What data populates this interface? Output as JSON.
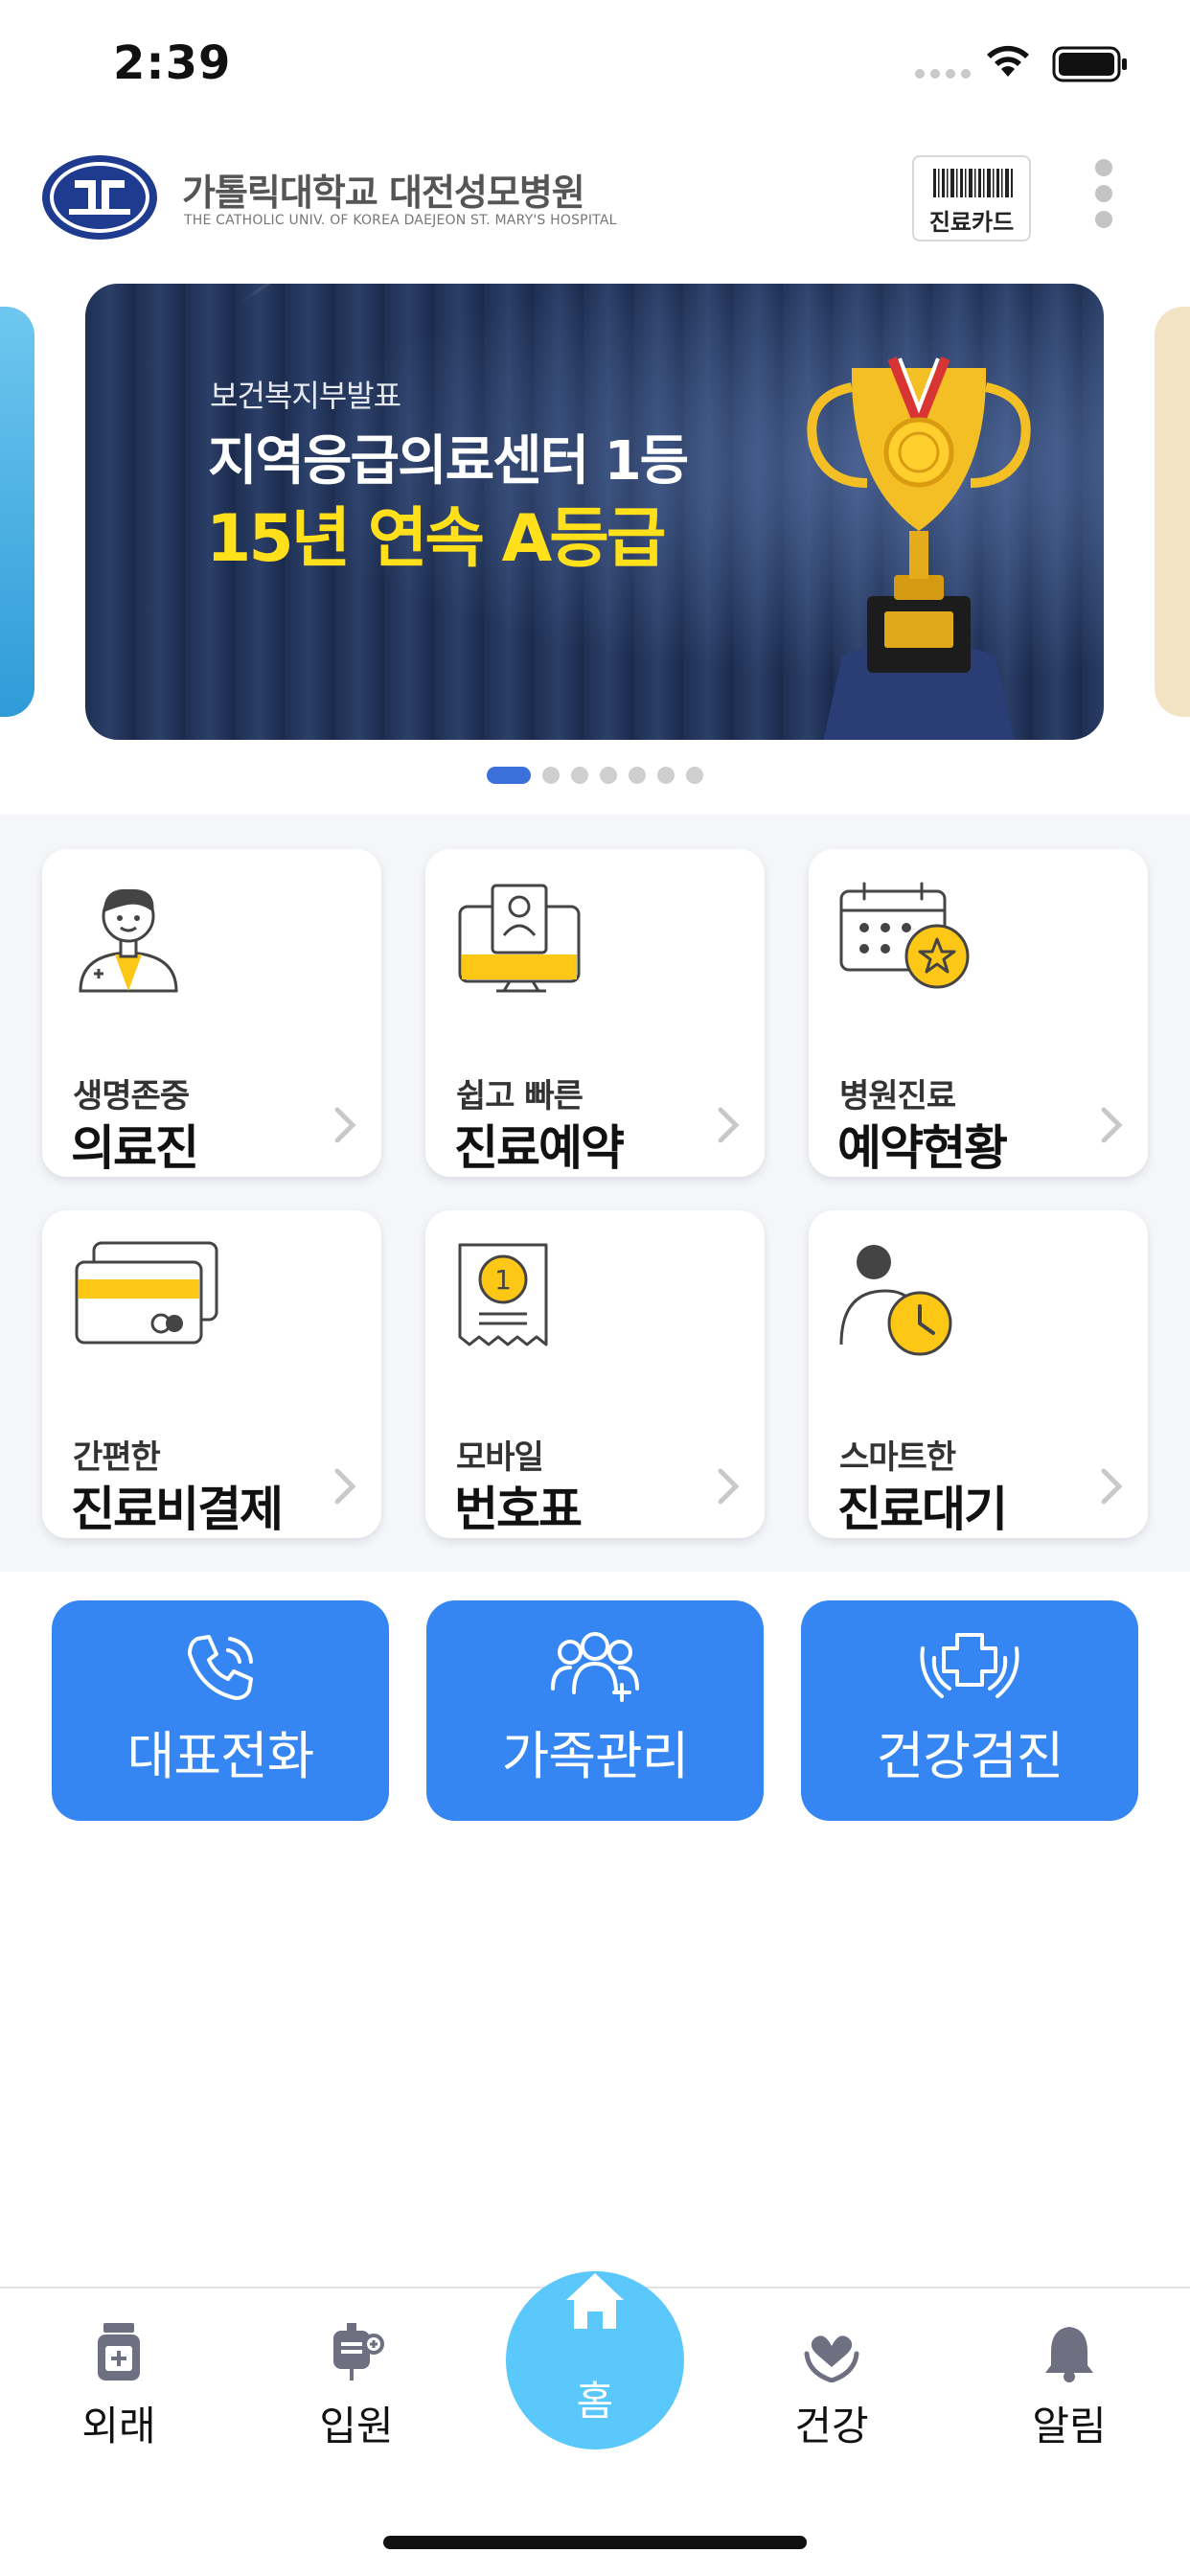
{
  "status_bar": {
    "time": "2:39"
  },
  "header": {
    "hospital_name": "가톨릭대학교 대전성모병원",
    "hospital_name_en": "THE CATHOLIC UNIV. OF KOREA DAEJEON ST. MARY'S HOSPITAL",
    "card_button_label": "진료카드"
  },
  "banner": {
    "kicker": "보건복지부발표",
    "line1": "지역응급의료센터 1등",
    "line2": "15년 연속 A등급",
    "slide_count": 7,
    "active_index": 0,
    "colors": {
      "highlight": "#ffe01a",
      "background": "#1e2f52"
    }
  },
  "menu": {
    "tiles": [
      {
        "sub": "생명존중",
        "main": "의료진",
        "icon": "doctor-icon"
      },
      {
        "sub": "쉽고 빠른",
        "main": "진료예약",
        "icon": "monitor-profile-icon"
      },
      {
        "sub": "병원진료",
        "main": "예약현황",
        "icon": "calendar-star-icon"
      },
      {
        "sub": "간편한",
        "main": "진료비결제",
        "icon": "credit-card-icon"
      },
      {
        "sub": "모바일",
        "main": "번호표",
        "icon": "ticket-number-icon"
      },
      {
        "sub": "스마트한",
        "main": "진료대기",
        "icon": "person-clock-icon"
      }
    ]
  },
  "quick_actions": [
    {
      "label": "대표전화",
      "icon": "phone-icon"
    },
    {
      "label": "가족관리",
      "icon": "family-icon"
    },
    {
      "label": "건강검진",
      "icon": "care-hands-icon"
    }
  ],
  "tabbar": {
    "tabs": [
      {
        "label": "외래",
        "icon": "medicine-bottle-icon"
      },
      {
        "label": "입원",
        "icon": "iv-bag-icon"
      },
      {
        "label": "홈",
        "icon": "home-icon"
      },
      {
        "label": "건강",
        "icon": "heart-hands-icon"
      },
      {
        "label": "알림",
        "icon": "bell-icon"
      }
    ],
    "active": "홈"
  },
  "theme": {
    "accent": "#3586f2",
    "home_tab": "#5ac8fa",
    "yellow": "#fdc716"
  }
}
